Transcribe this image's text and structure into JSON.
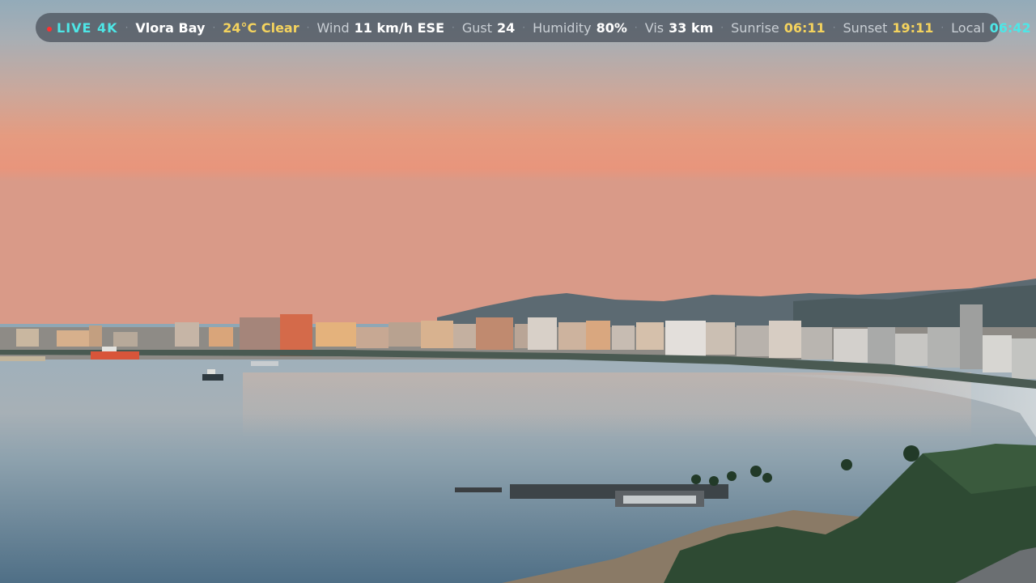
{
  "overlay": {
    "live_label": "LIVE 4K",
    "location": "Vlora Bay",
    "weather": "24°C Clear",
    "wind_label": "Wind",
    "wind_value": "11 km/h ESE",
    "gust_label": "Gust",
    "gust_value": "24",
    "humidity_label": "Humidity",
    "humidity_value": "80%",
    "vis_label": "Vis",
    "vis_value": "33 km",
    "sunrise_label": "Sunrise",
    "sunrise_value": "06:11",
    "sunset_label": "Sunset",
    "sunset_value": "19:11",
    "local_label": "Local",
    "local_value": "06:42",
    "separator": "·"
  },
  "colors": {
    "live_accent": "#4ee6e6",
    "live_dot": "#ff3030",
    "warm_accent": "#f4d35e",
    "bar_background": "rgba(70,78,88,0.72)"
  }
}
